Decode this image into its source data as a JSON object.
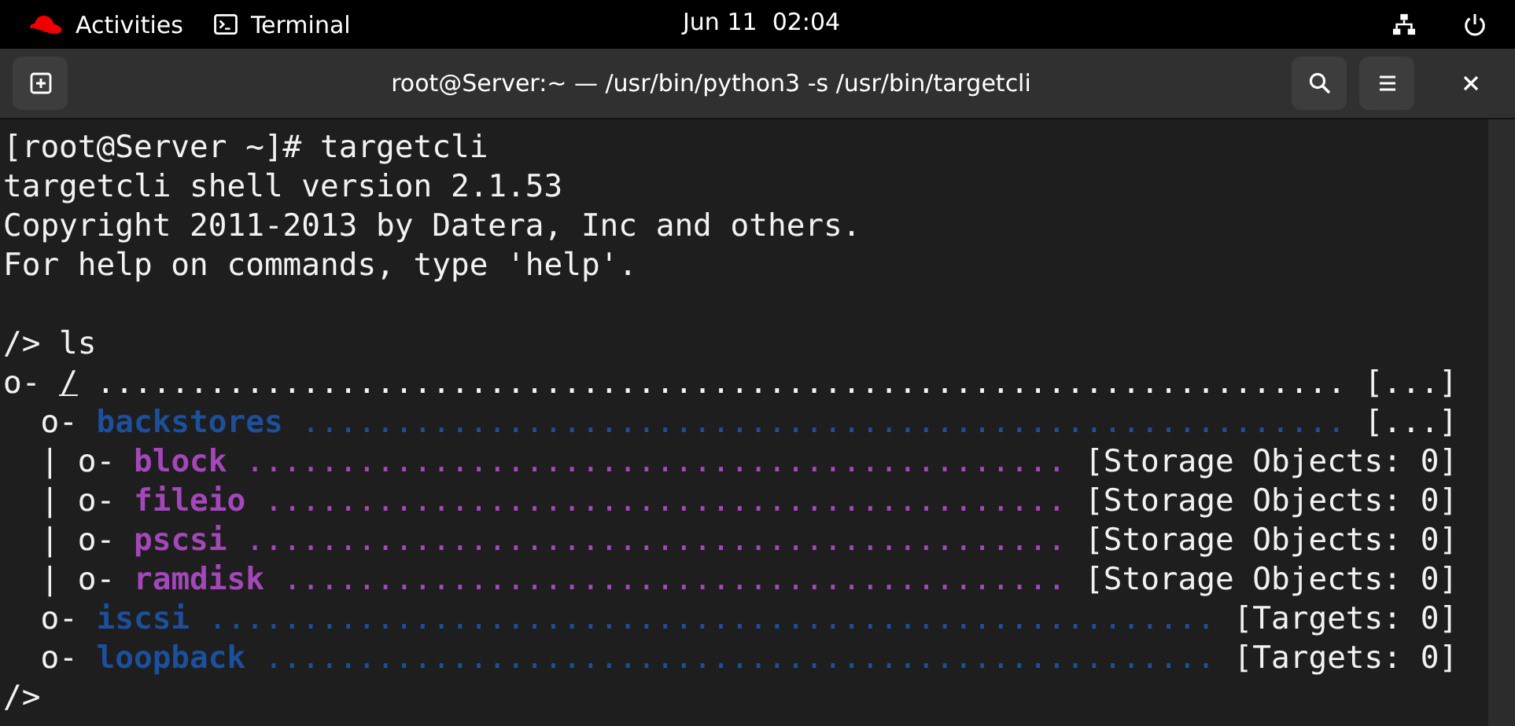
{
  "top_bar": {
    "activities": "Activities",
    "app": "Terminal",
    "clock": "Jun 11  02:04"
  },
  "window": {
    "title": "root@Server:~ — /usr/bin/python3 -s /usr/bin/targetcli"
  },
  "terminal": {
    "lines": [
      {
        "segments": [
          {
            "text": "[root@Server ~]# targetcli"
          }
        ]
      },
      {
        "segments": [
          {
            "text": "targetcli shell version 2.1.53"
          }
        ]
      },
      {
        "segments": [
          {
            "text": "Copyright 2011-2013 by Datera, Inc and others."
          }
        ]
      },
      {
        "segments": [
          {
            "text": "For help on commands, type 'help'."
          }
        ]
      },
      {
        "gap_before": true,
        "segments": [
          {
            "text": "/> ls"
          }
        ]
      },
      {
        "segments": [
          {
            "text": "o- "
          },
          {
            "text": "/",
            "underline": true
          },
          {
            "text": " ..................................................................."
          },
          {
            "text": " [...]"
          }
        ]
      },
      {
        "segments": [
          {
            "text": "  o- "
          },
          {
            "text": "backstores",
            "bold": true,
            "color": "#1c4f9c"
          },
          {
            "text": " ........................................................",
            "color": "#1c4f9c"
          },
          {
            "text": " [...]"
          }
        ]
      },
      {
        "segments": [
          {
            "text": "  | o- "
          },
          {
            "text": "block",
            "bold": true,
            "color": "#a347ba"
          },
          {
            "text": " ............................................",
            "color": "#a347ba"
          },
          {
            "text": " [Storage Objects: 0]"
          }
        ]
      },
      {
        "segments": [
          {
            "text": "  | o- "
          },
          {
            "text": "fileio",
            "bold": true,
            "color": "#a347ba"
          },
          {
            "text": " ...........................................",
            "color": "#a347ba"
          },
          {
            "text": " [Storage Objects: 0]"
          }
        ]
      },
      {
        "segments": [
          {
            "text": "  | o- "
          },
          {
            "text": "pscsi",
            "bold": true,
            "color": "#a347ba"
          },
          {
            "text": " ............................................",
            "color": "#a347ba"
          },
          {
            "text": " [Storage Objects: 0]"
          }
        ]
      },
      {
        "segments": [
          {
            "text": "  | o- "
          },
          {
            "text": "ramdisk",
            "bold": true,
            "color": "#a347ba"
          },
          {
            "text": " ..........................................",
            "color": "#a347ba"
          },
          {
            "text": " [Storage Objects: 0]"
          }
        ]
      },
      {
        "segments": [
          {
            "text": "  o- "
          },
          {
            "text": "iscsi",
            "bold": true,
            "color": "#1c4f9c"
          },
          {
            "text": " ......................................................",
            "color": "#1c4f9c"
          },
          {
            "text": " [Targets: 0]"
          }
        ]
      },
      {
        "segments": [
          {
            "text": "  o- "
          },
          {
            "text": "loopback",
            "bold": true,
            "color": "#1c4f9c"
          },
          {
            "text": " ...................................................",
            "color": "#1c4f9c"
          },
          {
            "text": " [Targets: 0]"
          }
        ]
      },
      {
        "segments": [
          {
            "text": "/>"
          }
        ]
      }
    ]
  }
}
